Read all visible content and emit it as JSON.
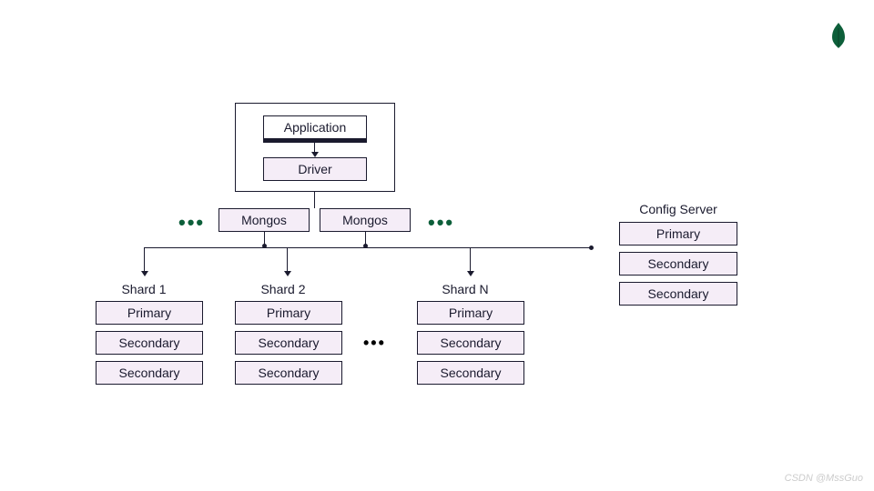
{
  "logo_name": "mongodb-leaf-icon",
  "app_container": {
    "application": "Application",
    "driver": "Driver"
  },
  "routers": {
    "mongos1": "Mongos",
    "mongos2": "Mongos"
  },
  "config_server": {
    "title": "Config Server",
    "primary": "Primary",
    "secondary1": "Secondary",
    "secondary2": "Secondary"
  },
  "shards": [
    {
      "title": "Shard 1",
      "primary": "Primary",
      "secondary1": "Secondary",
      "secondary2": "Secondary"
    },
    {
      "title": "Shard 2",
      "primary": "Primary",
      "secondary1": "Secondary",
      "secondary2": "Secondary"
    },
    {
      "title": "Shard N",
      "primary": "Primary",
      "secondary1": "Secondary",
      "secondary2": "Secondary"
    }
  ],
  "ellipsis": "•••",
  "watermark": "CSDN @MssGuo"
}
